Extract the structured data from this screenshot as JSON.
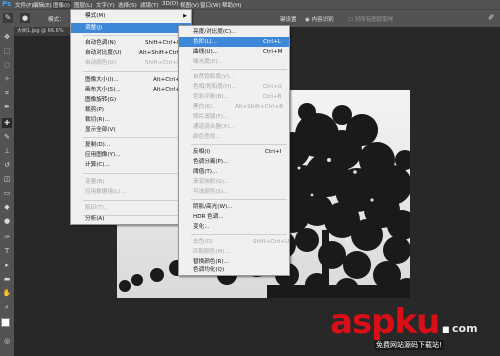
{
  "app": {
    "logo": "Ps"
  },
  "menubar": [
    "文件(F)",
    "编辑(E)",
    "图像(I)",
    "图层(L)",
    "文字(Y)",
    "选择(S)",
    "滤镜(T)",
    "3D(D)",
    "视图(V)",
    "窗口(W)",
    "帮助(H)"
  ],
  "options": {
    "mode_label": "模式：",
    "mode_value": "正常",
    "opacity_label": "不透明度：",
    "tail1": "键设置",
    "tail2": "内容识别",
    "tail3": "对所有图层取样"
  },
  "document": {
    "tab": "大树1.jpg @ 66.6%"
  },
  "image_menu": [
    {
      "label": "模式(M)",
      "shortcut": "",
      "submenu": true,
      "disabled": false,
      "selected": false
    },
    {
      "label": "调整(J)",
      "shortcut": "",
      "submenu": true,
      "disabled": false,
      "selected": true
    },
    {
      "label": "自动色调(N)",
      "shortcut": "Shift+Ctrl+L",
      "submenu": false,
      "disabled": false,
      "selected": false
    },
    {
      "label": "自动对比度(U)",
      "shortcut": "Alt+Shift+Ctrl+L",
      "submenu": false,
      "disabled": false,
      "selected": false
    },
    {
      "label": "自动颜色(O)",
      "shortcut": "Shift+Ctrl+B",
      "submenu": false,
      "disabled": true,
      "selected": false
    },
    {
      "label": "图像大小(I)...",
      "shortcut": "Alt+Ctrl+I",
      "submenu": false,
      "disabled": false,
      "selected": false
    },
    {
      "label": "画布大小(S)...",
      "shortcut": "Alt+Ctrl+C",
      "submenu": false,
      "disabled": false,
      "selected": false
    },
    {
      "label": "图像旋转(G)",
      "shortcut": "",
      "submenu": true,
      "disabled": false,
      "selected": false
    },
    {
      "label": "裁剪(P)",
      "shortcut": "",
      "submenu": false,
      "disabled": false,
      "selected": false
    },
    {
      "label": "裁切(R)...",
      "shortcut": "",
      "submenu": false,
      "disabled": false,
      "selected": false
    },
    {
      "label": "显示全部(V)",
      "shortcut": "",
      "submenu": false,
      "disabled": false,
      "selected": false
    },
    {
      "label": "复制(D)...",
      "shortcut": "",
      "submenu": false,
      "disabled": false,
      "selected": false
    },
    {
      "label": "应用图像(Y)...",
      "shortcut": "",
      "submenu": false,
      "disabled": false,
      "selected": false
    },
    {
      "label": "计算(C)...",
      "shortcut": "",
      "submenu": false,
      "disabled": false,
      "selected": false
    },
    {
      "label": "变量(B)",
      "shortcut": "",
      "submenu": true,
      "disabled": true,
      "selected": false
    },
    {
      "label": "应用数据组(L)...",
      "shortcut": "",
      "submenu": false,
      "disabled": true,
      "selected": false
    },
    {
      "label": "陷印(T)...",
      "shortcut": "",
      "submenu": false,
      "disabled": true,
      "selected": false
    },
    {
      "label": "分析(A)",
      "shortcut": "",
      "submenu": true,
      "disabled": false,
      "selected": false
    }
  ],
  "adjust_menu": [
    {
      "label": "亮度/对比度(C)...",
      "shortcut": "",
      "disabled": false,
      "selected": false
    },
    {
      "label": "色阶(L)...",
      "shortcut": "Ctrl+L",
      "disabled": false,
      "selected": true
    },
    {
      "label": "曲线(U)...",
      "shortcut": "Ctrl+M",
      "disabled": false,
      "selected": false
    },
    {
      "label": "曝光度(E)...",
      "shortcut": "",
      "disabled": true,
      "selected": false
    },
    {
      "label": "自然饱和度(V)...",
      "shortcut": "",
      "disabled": true,
      "selected": false
    },
    {
      "label": "色相/饱和度(H)...",
      "shortcut": "Ctrl+U",
      "disabled": true,
      "selected": false
    },
    {
      "label": "色彩平衡(B)...",
      "shortcut": "Ctrl+B",
      "disabled": true,
      "selected": false
    },
    {
      "label": "黑白(K)...",
      "shortcut": "Alt+Shift+Ctrl+B",
      "disabled": true,
      "selected": false
    },
    {
      "label": "照片滤镜(F)...",
      "shortcut": "",
      "disabled": true,
      "selected": false
    },
    {
      "label": "通道混合器(X)...",
      "shortcut": "",
      "disabled": true,
      "selected": false
    },
    {
      "label": "颜色查找...",
      "shortcut": "",
      "disabled": true,
      "selected": false
    },
    {
      "label": "反相(I)",
      "shortcut": "Ctrl+I",
      "disabled": false,
      "selected": false
    },
    {
      "label": "色调分离(P)...",
      "shortcut": "",
      "disabled": false,
      "selected": false
    },
    {
      "label": "阈值(T)...",
      "shortcut": "",
      "disabled": false,
      "selected": false
    },
    {
      "label": "渐变映射(G)...",
      "shortcut": "",
      "disabled": true,
      "selected": false
    },
    {
      "label": "可选颜色(S)...",
      "shortcut": "",
      "disabled": true,
      "selected": false
    },
    {
      "label": "阴影/高光(W)...",
      "shortcut": "",
      "disabled": false,
      "selected": false
    },
    {
      "label": "HDR 色调...",
      "shortcut": "",
      "disabled": false,
      "selected": false
    },
    {
      "label": "变化...",
      "shortcut": "",
      "disabled": false,
      "selected": false
    },
    {
      "label": "去色(D)",
      "shortcut": "Shift+Ctrl+U",
      "disabled": true,
      "selected": false
    },
    {
      "label": "匹配颜色(M)...",
      "shortcut": "",
      "disabled": true,
      "selected": false
    },
    {
      "label": "替换颜色(R)...",
      "shortcut": "",
      "disabled": false,
      "selected": false
    },
    {
      "label": "色调均化(Q)",
      "shortcut": "",
      "disabled": false,
      "selected": false
    }
  ],
  "watermark": {
    "brand_a": "aspku",
    "brand_dot": ".",
    "brand_tld": "com",
    "sub": "免费网站源码下载站!"
  },
  "colors": {
    "menu_bg": "#f0f0f0",
    "selection": "#3d88d8",
    "watermark_red": "#d80f16"
  }
}
